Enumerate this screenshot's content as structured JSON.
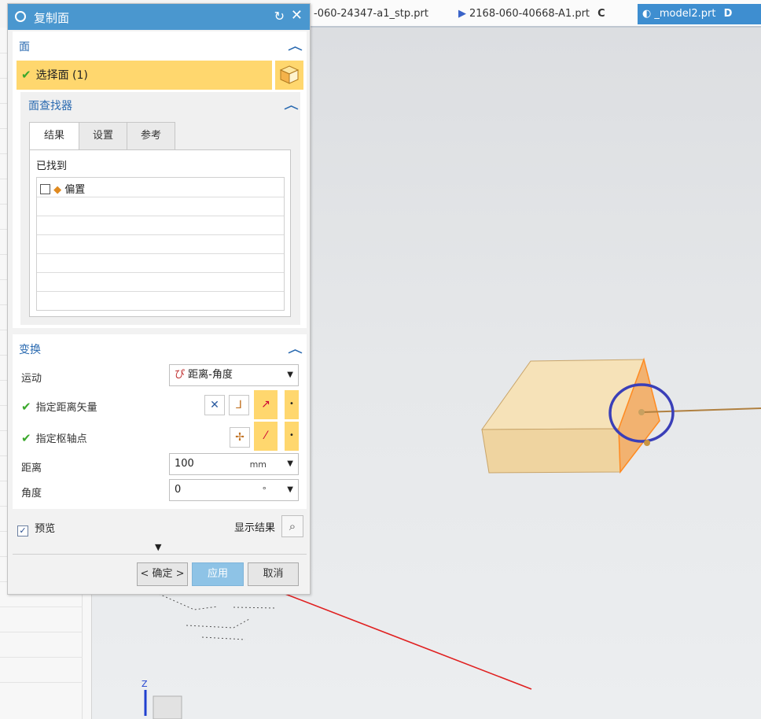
{
  "tabs": [
    {
      "label": "-060-24347-a1_stp.prt"
    },
    {
      "label": "2168-060-40668-A1.prt",
      "status": "C"
    },
    {
      "label": "_model2.prt",
      "status": "D"
    }
  ],
  "dialog": {
    "title": "复制面",
    "face_section": {
      "title": "面",
      "select_label": "选择面 (1)",
      "finder": {
        "title": "面查找器",
        "tabs": [
          "结果",
          "设置",
          "参考"
        ],
        "found_label": "已找到",
        "items": [
          {
            "label": "偏置"
          }
        ]
      }
    },
    "transform_section": {
      "title": "变换",
      "motion_label": "运动",
      "motion_value": "距离-角度",
      "vector_label": "指定距离矢量",
      "pivot_label": "指定枢轴点",
      "distance_label": "距离",
      "distance_value": "100",
      "distance_unit": "mm",
      "angle_label": "角度",
      "angle_value": "0",
      "angle_unit": "°"
    },
    "preview_label": "预览",
    "show_result_label": "显示结果",
    "buttons": {
      "ok": "< 确定 >",
      "apply": "应用",
      "cancel": "取消"
    }
  },
  "colors": {
    "title_bar": "#4a97cf",
    "selection": "#ffd76e",
    "arrow": "#e02020",
    "ring": "#3a3fb8",
    "block": "#f2d8a6"
  }
}
